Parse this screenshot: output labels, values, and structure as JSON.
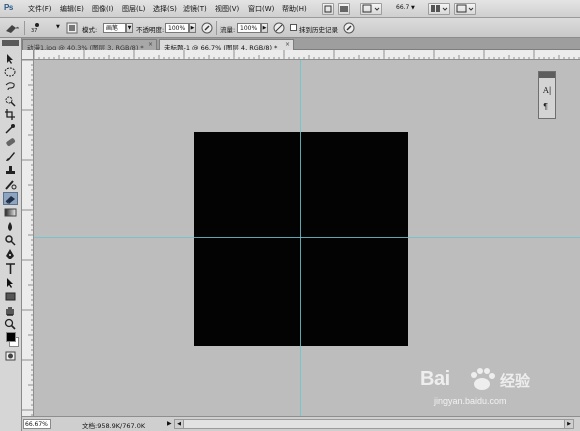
{
  "app": {
    "logo_text": "Ps"
  },
  "menu": {
    "items": [
      "文件(F)",
      "编辑(E)",
      "图像(I)",
      "图层(L)",
      "选择(S)",
      "滤镜(T)",
      "视图(V)",
      "窗口(W)",
      "帮助(H)"
    ],
    "zoom_value": "66.7"
  },
  "options": {
    "brush_size": "37",
    "mode_label": "模式:",
    "mode_value": "画笔",
    "opacity_label": "不透明度:",
    "opacity_value": "100%",
    "flow_label": "流量:",
    "flow_value": "100%",
    "history_label": "抹到历史记录",
    "history_checked": false
  },
  "tabs": [
    {
      "label": "动漫1.jpg @ 40.3% (图层 3, RGB/8) *",
      "close": "×",
      "active": false
    },
    {
      "label": "未标题-1 @ 66.7% (图层 4, RGB/8) *",
      "close": "×",
      "active": true
    }
  ],
  "float_panel": {
    "glyph_1": "A|",
    "glyph_2": "¶"
  },
  "status": {
    "zoom_level": "66.67%",
    "doc_info": "文档:958.9K/767.0K",
    "arrow": "▶"
  },
  "watermark": {
    "brand": "Bai",
    "brand_cn": "经验",
    "url": "jingyan.baidu.com"
  },
  "colors": {
    "canvas": "#030303",
    "workspace": "#bdbdbd",
    "guide": "#6fc4cf",
    "foreground": "#000000",
    "background": "#ffffff"
  },
  "icons": {
    "toolbox": [
      "move-icon",
      "marquee-icon",
      "lasso-icon",
      "quick-select-icon",
      "crop-icon",
      "eyedropper-icon",
      "healing-icon",
      "brush-icon",
      "clone-stamp-icon",
      "history-brush-icon",
      "eraser-icon",
      "gradient-icon",
      "blur-icon",
      "dodge-icon",
      "pen-icon",
      "type-icon",
      "path-select-icon",
      "rectangle-icon",
      "hand-icon",
      "zoom-icon"
    ]
  }
}
